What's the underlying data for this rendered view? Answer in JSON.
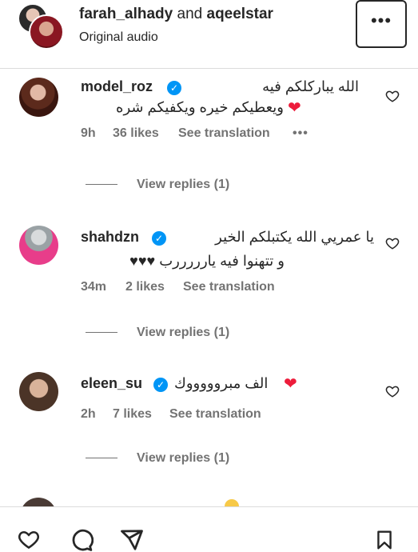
{
  "header": {
    "user1": "farah_alhady",
    "conj": "and",
    "user2": "aqeelstar",
    "audio": "Original audio",
    "more_label": "•••"
  },
  "comments": [
    {
      "username": "model_roz",
      "verified": true,
      "text_line1": "الله يباركلكم فيه",
      "text_line2": "ويعطيكم خيره ويكفيكم شره",
      "emoji": "heart-red",
      "time": "9h",
      "likes": "36 likes",
      "translate": "See translation",
      "options": "•••",
      "replies": "View replies (1)"
    },
    {
      "username": "shahdzn",
      "verified": true,
      "text_line1": "يا عمريي الله يكتبلكم الخير",
      "text_line2": "و تتهنوا فيه يارررررب ♥♥♥",
      "time": "34m",
      "likes": "2 likes",
      "translate": "See translation",
      "replies": "View replies (1)"
    },
    {
      "username": "eleen_su",
      "verified": true,
      "text_line1": "الف مبروووووك",
      "emoji": "heart-red",
      "time": "2h",
      "likes": "7 likes",
      "translate": "See translation",
      "replies": "View replies (1)"
    }
  ],
  "colors": {
    "verified": "#0095f6",
    "meta_gray": "#737373",
    "red_heart": "#ed1c3b",
    "text": "#262626"
  }
}
